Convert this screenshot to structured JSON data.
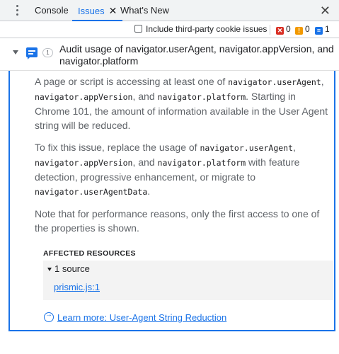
{
  "tabs": [
    {
      "label": "Console",
      "active": false
    },
    {
      "label": "Issues",
      "active": true
    },
    {
      "label": "What's New",
      "active": false
    }
  ],
  "toolbar": {
    "checkbox_label": "Include third-party cookie issues",
    "errors": "0",
    "warnings": "0",
    "infos": "1"
  },
  "issue": {
    "count": "1",
    "title": "Audit usage of navigator.userAgent, navigator.appVersion, and navigator.platform",
    "p1": {
      "t1": "A page or script is accessing at least one of ",
      "c1": "navigator.userAgent",
      "t2": ", ",
      "c2": "navigator.appVersion",
      "t3": ", and ",
      "c3": "navigator.platform",
      "t4": ". Starting in Chrome 101, the amount of information available in the User Agent string will be reduced."
    },
    "p2": {
      "t1": "To fix this issue, replace the usage of ",
      "c1": "navigator.userAgent",
      "t2": ", ",
      "c2": "navigator.appVersion",
      "t3": ", and ",
      "c3": "navigator.platform",
      "t4": " with feature detection, progressive enhancement, or migrate to ",
      "c4": "navigator.userAgentData",
      "t5": "."
    },
    "p3": "Note that for performance reasons, only the first access to one of the properties is shown.",
    "affected_heading": "AFFECTED RESOURCES",
    "source_count_label": "1 source",
    "source_link": "prismic.js:1",
    "learn_more": "Learn more: User-Agent String Reduction"
  },
  "colors": {
    "accent": "#1a73e8",
    "error": "#d93025",
    "warning": "#f29900"
  }
}
